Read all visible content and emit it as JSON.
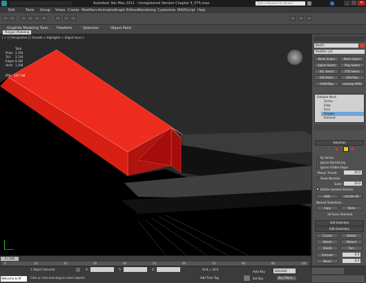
{
  "title_bar": {
    "title": "Autodesk 3ds Max  2011  -  Unregistered Version   Chapter 5_075.max",
    "search_placeholder": "Type a keyword or phrase"
  },
  "menu": [
    "Edit",
    "Tools",
    "Group",
    "Views",
    "Create",
    "Modifiers",
    "Animation",
    "Graph Editors",
    "Rendering",
    "Customize",
    "MAXScript",
    "Help"
  ],
  "ribbon": {
    "tabs": [
      "Graphite Modeling Tools",
      "Freeform",
      "Selection",
      "Object Paint"
    ],
    "sub_tab": "Polygon Modeling"
  },
  "viewport": {
    "label": "[ + ] [ Perspective ] [ Smooth + Highlights + Edged Faces ]",
    "stats": {
      "header": "Total",
      "polys_label": "Polys:",
      "polys": "2,164",
      "tris_label": "Tris:",
      "tris": "2,744",
      "edges_label": "Edges:",
      "edges": "8,382",
      "verts_label": "Verts:",
      "verts": "1,296",
      "fps_label": "FPS:",
      "fps": "147.744"
    }
  },
  "command_panel": {
    "object_name": "Box01",
    "modifier_list": "Modifier List",
    "buttons": [
      "Mesh Select",
      "Patch Select",
      "Spline Select",
      "Poly Select",
      "Vol. Select",
      "FFD Select",
      "Edit Mesh",
      "Edit Poly",
      "UVW Map",
      "Unwrap UVW"
    ],
    "stack": [
      "Editable Mesh",
      "Vertex",
      "Edge",
      "Face",
      "Polygon",
      "Element"
    ],
    "selection": {
      "title": "Selection",
      "by_vertex": "By Vertex",
      "ignore_backfacing": "Ignore Backfacing",
      "ignore_visible_edges": "Ignore Visible Edges",
      "planar_thresh_label": "Planar Thresh:",
      "planar_thresh_value": "45.0",
      "show_normals": "Show Normals",
      "scale_label": "Scale:",
      "scale_value": "20.0",
      "delete_isolated": "Delete Isolated Vertices",
      "hide": "Hide",
      "unhide_all": "Unhide All",
      "named_selections": "Named Selections:",
      "copy": "Copy",
      "paste": "Paste",
      "faces_selected": "16 Faces Selected"
    },
    "soft_selection": "Soft Selection",
    "edit_geometry": {
      "title": "Edit Geometry",
      "buttons": [
        "Create",
        "Delete",
        "Attach",
        "Detach",
        "Divide",
        "Turn",
        "Extrude",
        "Bevel"
      ],
      "extrude_value": "0.0",
      "bevel_value": "0.0"
    }
  },
  "timeline": {
    "frame": "0 / 100",
    "ticks": [
      "0",
      "10",
      "20",
      "30",
      "40",
      "50",
      "60",
      "70",
      "80",
      "90",
      "100"
    ]
  },
  "status": {
    "selected": "1 Object Selected",
    "prompt": "Click or click-and-drag to select objects",
    "welcome": "Welcome to M",
    "x_label": "X:",
    "y_label": "Y:",
    "z_label": "Z:",
    "grid": "Grid = 10.0",
    "add_time_tag": "Add Time Tag",
    "auto_key": "Auto Key",
    "set_key": "Set Key",
    "selected_dropdown": "Selected",
    "key_filters": "Key Filters..."
  },
  "colors": {
    "selection_red": "#ee2c1e",
    "dark_red": "#a50c0c",
    "viewport_bg": "#2a2a2a",
    "stack_highlight": "#6ea6d8"
  }
}
